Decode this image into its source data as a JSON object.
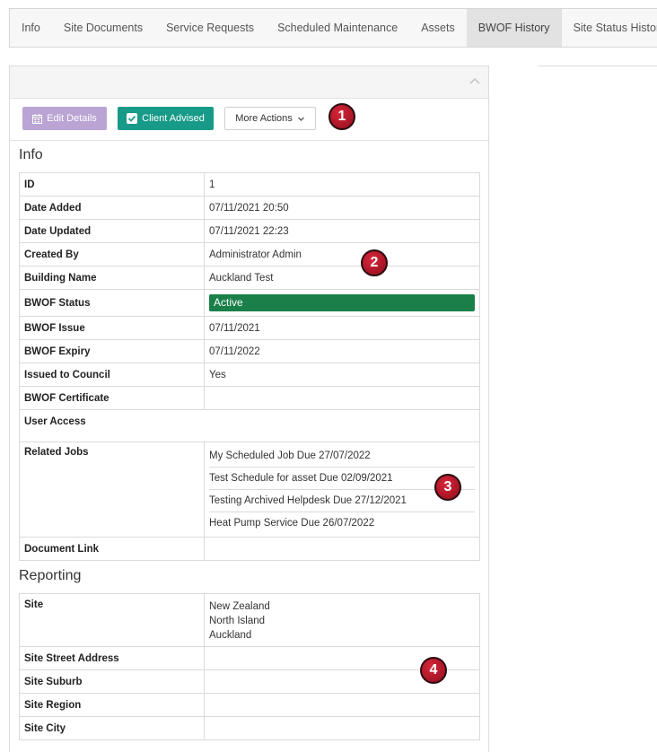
{
  "tabs": [
    "Info",
    "Site Documents",
    "Service Requests",
    "Scheduled Maintenance",
    "Assets",
    "BWOF History",
    "Site Status History"
  ],
  "active_tab": "BWOF History",
  "toolbar": {
    "edit_label": "Edit Details",
    "client_label": "Client Advised",
    "more_label": "More Actions"
  },
  "info": {
    "title": "Info",
    "rows": {
      "id": {
        "label": "ID",
        "value": "1"
      },
      "date_added": {
        "label": "Date Added",
        "value": "07/11/2021 20:50"
      },
      "date_updated": {
        "label": "Date Updated",
        "value": "07/11/2021 22:23"
      },
      "created_by": {
        "label": "Created By",
        "value": "Administrator Admin"
      },
      "building_name": {
        "label": "Building Name",
        "value": "Auckland Test"
      },
      "status": {
        "label": "BWOF Status",
        "value": "Active"
      },
      "issue": {
        "label": "BWOF Issue",
        "value": "07/11/2021"
      },
      "expiry": {
        "label": "BWOF Expiry",
        "value": "07/11/2022"
      },
      "council": {
        "label": "Issued to Council",
        "value": "Yes"
      },
      "certificate": {
        "label": "BWOF Certificate",
        "value": ""
      },
      "user_access": {
        "label": "User Access",
        "value": ""
      },
      "related_jobs": {
        "label": "Related Jobs"
      },
      "document_link": {
        "label": "Document Link",
        "value": ""
      }
    },
    "jobs": [
      "My Scheduled Job Due 27/07/2022",
      "Test Schedule for asset Due 02/09/2021",
      "Testing Archived Helpdesk Due 27/12/2021",
      "Heat Pump Service Due 26/07/2022"
    ]
  },
  "reporting": {
    "title": "Reporting",
    "site": {
      "label": "Site",
      "lines": [
        "New Zealand",
        "North Island",
        "Auckland"
      ]
    },
    "street": {
      "label": "Site Street Address",
      "value": ""
    },
    "suburb": {
      "label": "Site Suburb",
      "value": ""
    },
    "region": {
      "label": "Site Region",
      "value": ""
    },
    "city": {
      "label": "Site City",
      "value": ""
    }
  },
  "markers": [
    "1",
    "2",
    "3",
    "4"
  ],
  "colors": {
    "edit": "#b9a4d4",
    "client": "#179a87",
    "active": "#1a7f48",
    "marker": "#c0182d"
  }
}
